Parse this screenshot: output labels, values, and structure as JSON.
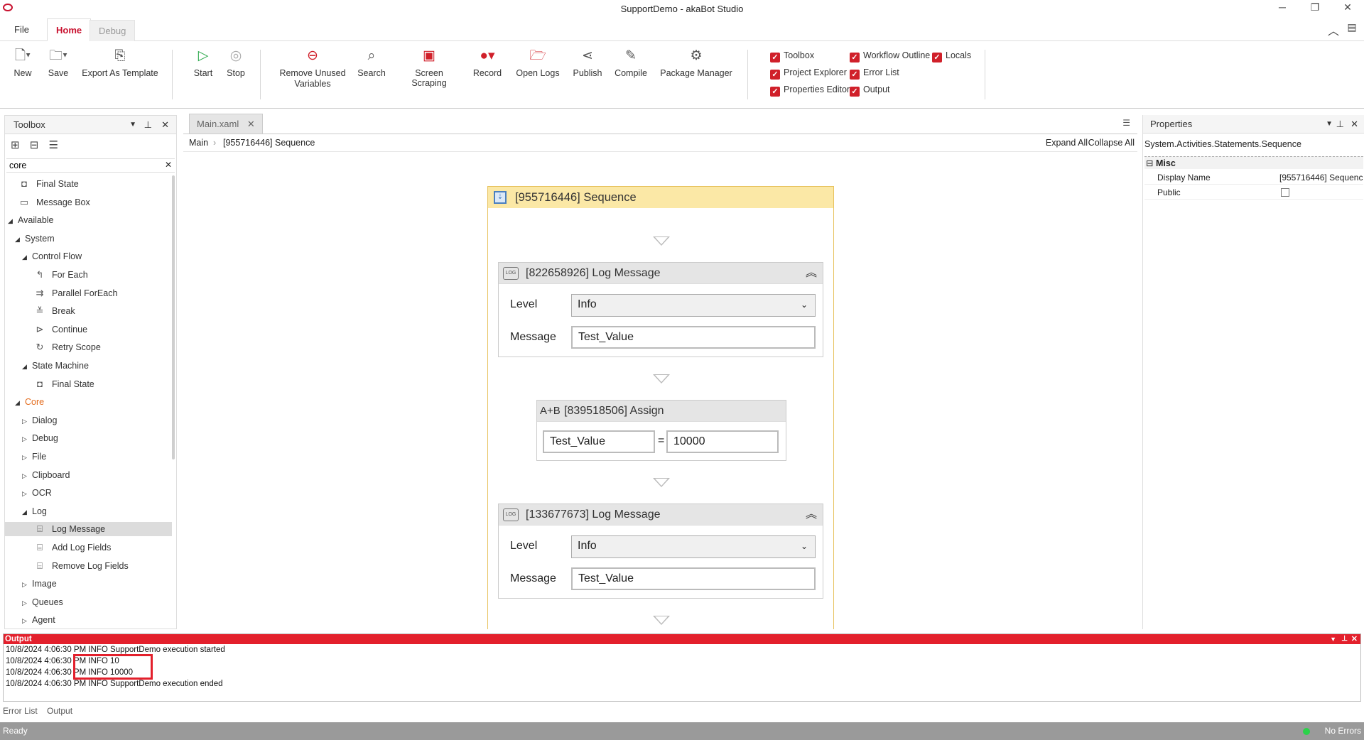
{
  "window": {
    "title": "SupportDemo - akaBot Studio"
  },
  "tabs": [
    {
      "label": "File"
    },
    {
      "label": "Home"
    },
    {
      "label": "Debug"
    }
  ],
  "ribbon": {
    "buttons": [
      {
        "label": "New",
        "icon": "new-file-icon"
      },
      {
        "label": "Save",
        "icon": "save-icon"
      },
      {
        "label": "Export As Template",
        "icon": "export-icon"
      },
      {
        "label": "Start",
        "icon": "play-icon"
      },
      {
        "label": "Stop",
        "icon": "stop-icon"
      },
      {
        "label": "Remove Unused Variables",
        "label1": "Remove Unused",
        "label2": "Variables",
        "icon": "remove-icon"
      },
      {
        "label": "Search",
        "icon": "search-icon"
      },
      {
        "label": "Screen Scraping",
        "icon": "screen-scraping-icon"
      },
      {
        "label": "Record",
        "icon": "record-icon"
      },
      {
        "label": "Open Logs",
        "icon": "open-logs-icon"
      },
      {
        "label": "Publish",
        "icon": "publish-icon"
      },
      {
        "label": "Compile",
        "icon": "compile-icon"
      },
      {
        "label": "Package Manager",
        "icon": "package-icon"
      }
    ],
    "checkboxes": [
      {
        "label": "Toolbox",
        "checked": true
      },
      {
        "label": "Project Explorer",
        "checked": true
      },
      {
        "label": "Properties Editor",
        "checked": true
      },
      {
        "label": "Workflow Outline",
        "checked": true
      },
      {
        "label": "Error List",
        "checked": true
      },
      {
        "label": "Output",
        "checked": true
      },
      {
        "label": "Locals",
        "checked": true
      }
    ]
  },
  "toolbox": {
    "title": "Toolbox",
    "search_value": "core",
    "items": [
      {
        "label": "Final State",
        "level": 1,
        "icon": "state-icon"
      },
      {
        "label": "Message Box",
        "level": 1,
        "icon": "message-icon"
      },
      {
        "label": "Available",
        "level": 0,
        "expanded": true
      },
      {
        "label": "System",
        "level": 1,
        "expanded": true
      },
      {
        "label": "Control Flow",
        "level": 2,
        "expanded": true
      },
      {
        "label": "For Each",
        "level": 3,
        "icon": "foreach-icon"
      },
      {
        "label": "Parallel ForEach",
        "level": 3,
        "icon": "parallel-icon"
      },
      {
        "label": "Break",
        "level": 3,
        "icon": "break-icon"
      },
      {
        "label": "Continue",
        "level": 3,
        "icon": "continue-icon"
      },
      {
        "label": "Retry Scope",
        "level": 3,
        "icon": "retry-icon"
      },
      {
        "label": "State Machine",
        "level": 2,
        "expanded": true
      },
      {
        "label": "Final State",
        "level": 3,
        "icon": "state-icon"
      },
      {
        "label": "Core",
        "level": 1,
        "expanded": true,
        "highlight": true
      },
      {
        "label": "Dialog",
        "level": 2,
        "expanded": false
      },
      {
        "label": "Debug",
        "level": 2,
        "expanded": false
      },
      {
        "label": "File",
        "level": 2,
        "expanded": false
      },
      {
        "label": "Clipboard",
        "level": 2,
        "expanded": false
      },
      {
        "label": "OCR",
        "level": 2,
        "expanded": false
      },
      {
        "label": "Log",
        "level": 2,
        "expanded": true
      },
      {
        "label": "Log Message",
        "level": 3,
        "icon": "log-icon",
        "selected": true
      },
      {
        "label": "Add Log Fields",
        "level": 3,
        "icon": "log-icon"
      },
      {
        "label": "Remove Log Fields",
        "level": 3,
        "icon": "log-icon"
      },
      {
        "label": "Image",
        "level": 2,
        "expanded": false
      },
      {
        "label": "Queues",
        "level": 2,
        "expanded": false
      },
      {
        "label": "Agent",
        "level": 2,
        "expanded": false
      }
    ]
  },
  "designer": {
    "doc_tab": "Main.xaml",
    "breadcrumb": [
      "Main",
      "[955716446] Sequence"
    ],
    "expand_all": "Expand All",
    "collapse_all": "Collapse All",
    "sequence": {
      "title": "[955716446] Sequence",
      "activities": [
        {
          "type": "log",
          "title": "[822658926] Log Message",
          "level_label": "Level",
          "level_value": "Info",
          "message_label": "Message",
          "message_value": "Test_Value"
        },
        {
          "type": "assign",
          "title": "[839518506] Assign",
          "icon_text": "A+B",
          "to": "Test_Value",
          "eq": "=",
          "value": "10000"
        },
        {
          "type": "log",
          "title": "[133677673] Log Message",
          "level_label": "Level",
          "level_value": "Info",
          "message_label": "Message",
          "message_value": "Test_Value"
        }
      ]
    }
  },
  "properties": {
    "title": "Properties",
    "type": "System.Activities.Statements.Sequence",
    "category": "Misc",
    "rows": [
      {
        "name": "Display Name",
        "value": "[955716446] Sequenc"
      },
      {
        "name": "Public",
        "value": ""
      }
    ]
  },
  "output": {
    "title": "Output",
    "lines": [
      "10/8/2024 4:06:30 PM INFO SupportDemo execution started",
      "10/8/2024 4:06:30 PM INFO 10",
      "10/8/2024 4:06:30 PM INFO 10000",
      "10/8/2024 4:06:30 PM INFO SupportDemo execution ended"
    ],
    "highlight_color": "#e3202c"
  },
  "bottom_tabs": [
    "Error List",
    "Output"
  ],
  "status": {
    "left": "Ready",
    "right": "No Errors"
  },
  "colors": {
    "accent": "#c8102e",
    "checkbox": "#d0202a",
    "sequence_header": "#fbe8a6",
    "output_header": "#e3202c"
  }
}
